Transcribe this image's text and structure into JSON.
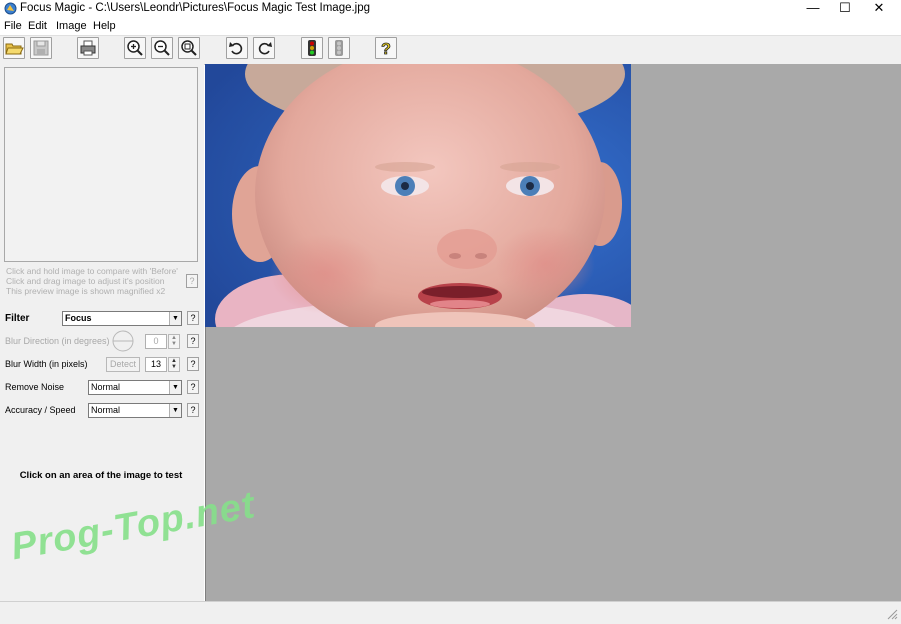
{
  "window": {
    "title": "Focus Magic - C:\\Users\\Leondr\\Pictures\\Focus Magic Test Image.jpg",
    "minimize": "—",
    "maximize": "☐",
    "close": "✕"
  },
  "menu": [
    "File",
    "Edit",
    "Image",
    "Help"
  ],
  "toolbar": {
    "icons": [
      "open-folder-icon",
      "save-icon",
      "print-icon",
      "zoom-in-icon",
      "zoom-out-icon",
      "zoom-fit-icon",
      "rotate-left-icon",
      "rotate-right-icon",
      "traffic-light-icon",
      "traffic-light-disabled-icon",
      "help-icon"
    ]
  },
  "preview": {
    "hint_lines": [
      "Click and hold image to compare with 'Before'",
      "Click and drag image to adjust it's position",
      "This preview image is shown magnified x2"
    ],
    "help": "?"
  },
  "controls": {
    "filter_label": "Filter",
    "filter_value": "Focus",
    "blur_direction_label": "Blur Direction (in degrees)",
    "blur_direction_value": "0",
    "blur_width_label": "Blur Width (in pixels)",
    "detect_label": "Detect",
    "blur_width_value": "13",
    "remove_noise_label": "Remove Noise",
    "remove_noise_value": "Normal",
    "accuracy_label": "Accuracy / Speed",
    "accuracy_value": "Normal",
    "help": "?"
  },
  "instruction": "Click on an area of the image to test",
  "watermark": "Prog-Top.net",
  "colors": {
    "panel": "#f0f0f0",
    "canvas": "#a9a9a9",
    "watermark": "#7ddc7d"
  }
}
